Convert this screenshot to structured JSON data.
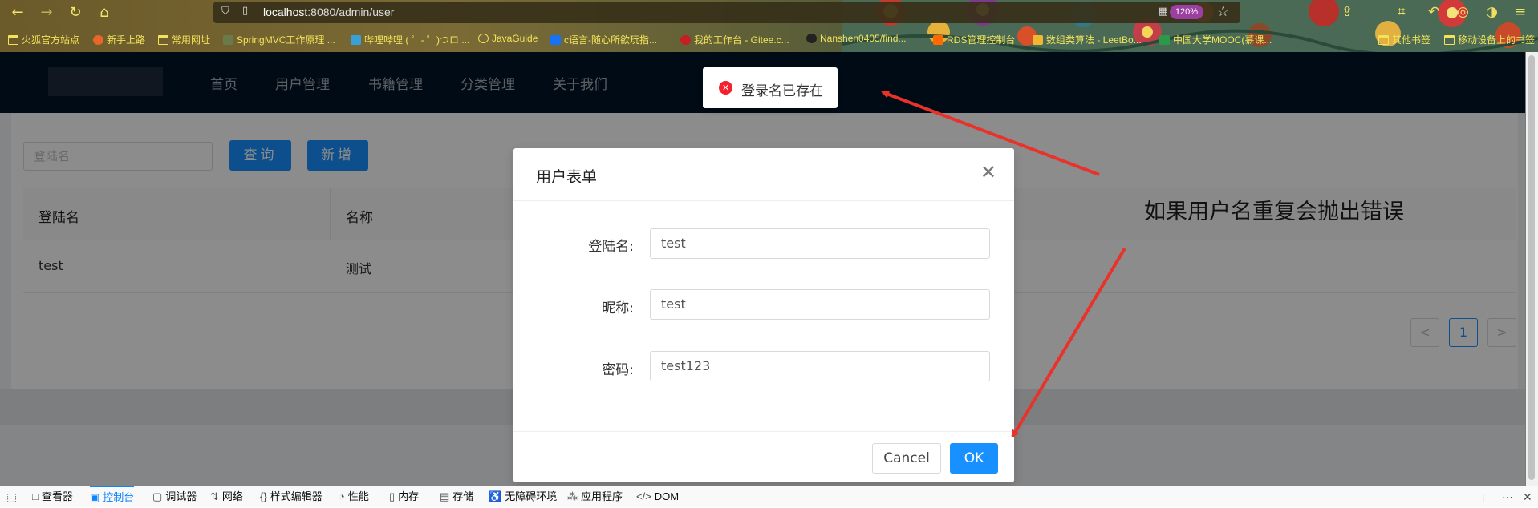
{
  "browser": {
    "url_scheme_host": "localhost",
    "url_rest": ":8080/admin/user",
    "zoom": "120%",
    "bookmarks": [
      "火狐官方站点",
      "新手上路",
      "常用网址",
      "SpringMVC工作原理 ...",
      "哔哩哔哩 ( ゜- ゜)つロ ...",
      "JavaGuide",
      "c语言-随心所欲玩指...",
      "我的工作台 - Gitee.c...",
      "Nanshen0405/find...",
      "RDS管理控制台",
      "数组类算法 - LeetBo...",
      "中国大学MOOC(慕课...",
      "其他书签",
      "移动设备上的书签"
    ]
  },
  "app": {
    "menu": [
      "首页",
      "用户管理",
      "书籍管理",
      "分类管理",
      "关于我们"
    ],
    "search_placeholder": "登陆名",
    "query_button": "查询",
    "add_button": "新增",
    "table": {
      "headers": [
        "登陆名",
        "名称"
      ],
      "rows": [
        [
          "test",
          "测试"
        ]
      ]
    },
    "pagination": {
      "prev": "<",
      "current": "1",
      "next": ">"
    }
  },
  "toast": {
    "message": "登录名已存在",
    "type": "error"
  },
  "modal": {
    "title": "用户表单",
    "fields": [
      {
        "label": "登陆名:",
        "value": "test"
      },
      {
        "label": "昵称:",
        "value": "test"
      },
      {
        "label": "密码:",
        "value": "test123"
      }
    ],
    "cancel": "Cancel",
    "ok": "OK"
  },
  "annotation": {
    "text": "如果用户名重复会抛出错误"
  },
  "devtools": {
    "tabs": [
      "查看器",
      "控制台",
      "调试器",
      "网络",
      "样式编辑器",
      "性能",
      "内存",
      "存储",
      "无障碍环境",
      "应用程序",
      "DOM"
    ],
    "active_tab": "控制台"
  },
  "colors": {
    "primary": "#1890ff",
    "header_bg": "#001529",
    "error": "#f5222d",
    "annotation_arrow": "#e8322a"
  }
}
